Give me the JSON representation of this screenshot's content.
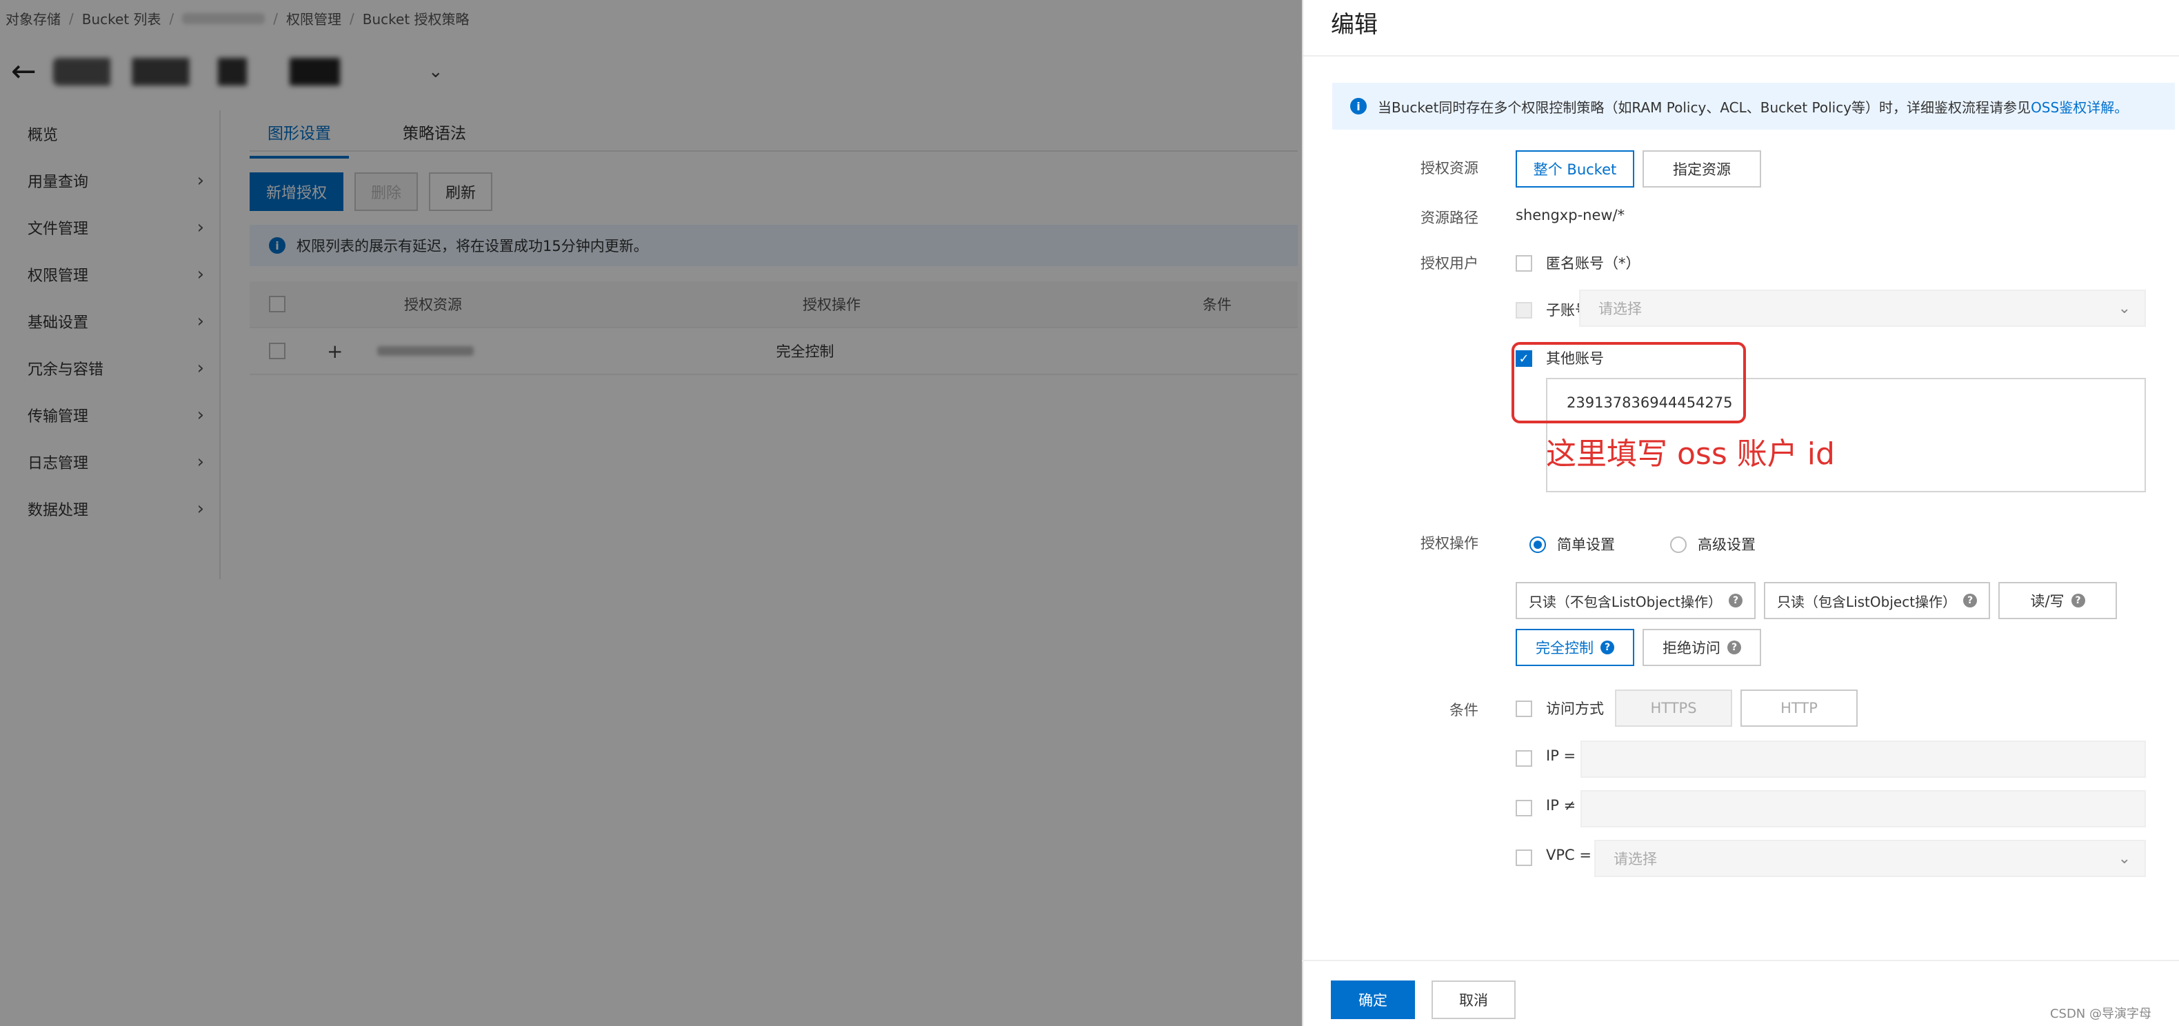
{
  "breadcrumb": [
    "对象存储",
    "Bucket 列表",
    "权限管理",
    "Bucket 授权策略"
  ],
  "side_nav": [
    {
      "label": "概览",
      "has_arrow": false
    },
    {
      "label": "用量查询",
      "has_arrow": true
    },
    {
      "label": "文件管理",
      "has_arrow": true
    },
    {
      "label": "权限管理",
      "has_arrow": true
    },
    {
      "label": "基础设置",
      "has_arrow": true
    },
    {
      "label": "冗余与容错",
      "has_arrow": true
    },
    {
      "label": "传输管理",
      "has_arrow": true
    },
    {
      "label": "日志管理",
      "has_arrow": true
    },
    {
      "label": "数据处理",
      "has_arrow": true
    }
  ],
  "tabs": [
    "图形设置",
    "策略语法"
  ],
  "toolbar": {
    "add": "新增授权",
    "delete": "删除",
    "refresh": "刷新"
  },
  "bg_notice": "权限列表的展示有延迟，将在设置成功15分钟内更新。",
  "bg_table": {
    "headers": [
      "授权资源",
      "授权操作",
      "条件"
    ],
    "row_action": "完全控制"
  },
  "drawer": {
    "title": "编辑",
    "notice_text": "当Bucket同时存在多个权限控制策略（如RAM Policy、ACL、Bucket Policy等）时，详细鉴权流程请参见",
    "notice_link": "OSS鉴权详解。",
    "labels": {
      "resource": "授权资源",
      "path": "资源路径",
      "users": "授权用户",
      "action": "授权操作",
      "condition": "条件"
    },
    "resource_options": [
      "整个 Bucket",
      "指定资源"
    ],
    "path_value": "shengxp-new/*",
    "anon_label": "匿名账号（*）",
    "sub_label": "子账号",
    "select_placeholder": "请选择",
    "other_label": "其他账号",
    "other_value": "239137836944454275",
    "annotation": "这里填写 oss 账户 id",
    "action_modes": [
      "简单设置",
      "高级设置"
    ],
    "action_options": [
      "只读（不包含ListObject操作）",
      "只读（包含ListObject操作）",
      "读/写",
      "完全控制",
      "拒绝访问"
    ],
    "cond_access": "访问方式",
    "cond_protocols": [
      "HTTPS",
      "HTTP"
    ],
    "cond_ip_eq": "IP =",
    "cond_ip_ne": "IP ≠",
    "cond_vpc": "VPC =",
    "ok": "确定",
    "cancel": "取消"
  },
  "watermark": "CSDN @导演字母",
  "colors": {
    "accent": "#0070cc",
    "annotation": "#e0332f"
  }
}
